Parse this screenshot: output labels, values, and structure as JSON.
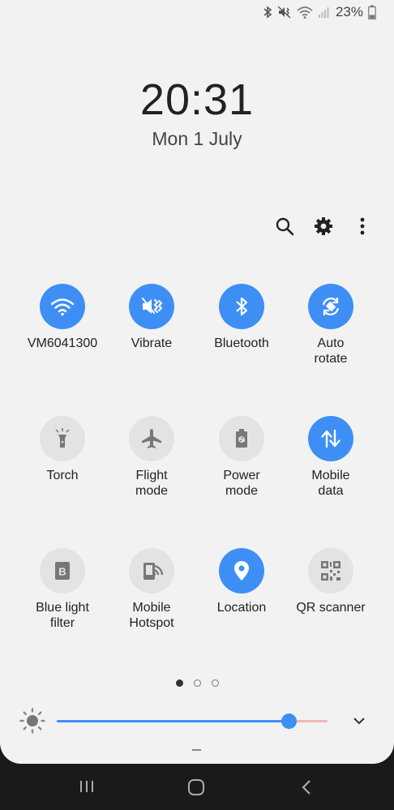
{
  "status": {
    "battery_percent": "23%",
    "icons": [
      "bluetooth-icon",
      "vibrate-icon",
      "wifi-icon",
      "signal-icon",
      "battery-icon"
    ]
  },
  "clock": {
    "time": "20:31",
    "date": "Mon 1 July"
  },
  "actions": [
    "search-icon",
    "gear-icon",
    "more-options-icon"
  ],
  "tiles": [
    {
      "label": "VM6041300",
      "state": "on",
      "icon": "wifi-icon"
    },
    {
      "label": "Vibrate",
      "state": "on",
      "icon": "vibrate-icon"
    },
    {
      "label": "Bluetooth",
      "state": "on",
      "icon": "bluetooth-icon"
    },
    {
      "label": "Auto\nrotate",
      "state": "on",
      "icon": "auto-rotate-icon"
    },
    {
      "label": "Torch",
      "state": "off",
      "icon": "torch-icon"
    },
    {
      "label": "Flight\nmode",
      "state": "off",
      "icon": "airplane-icon"
    },
    {
      "label": "Power\nmode",
      "state": "off",
      "icon": "battery-saver-icon"
    },
    {
      "label": "Mobile\ndata",
      "state": "on",
      "icon": "mobile-data-icon"
    },
    {
      "label": "Blue light\nfilter",
      "state": "off",
      "icon": "blue-light-icon"
    },
    {
      "label": "Mobile\nHotspot",
      "state": "off",
      "icon": "hotspot-icon"
    },
    {
      "label": "Location",
      "state": "on",
      "icon": "location-icon"
    },
    {
      "label": "QR scanner",
      "state": "off",
      "icon": "qr-icon"
    }
  ],
  "pagination": {
    "current": 1,
    "total": 3
  },
  "brightness": {
    "value": 0.86
  },
  "colors": {
    "accent": "#3d8ff5",
    "panel": "#f2f2f2",
    "navbar": "#1a1a1a"
  },
  "navbar": [
    "recents-icon",
    "home-icon",
    "back-icon"
  ]
}
